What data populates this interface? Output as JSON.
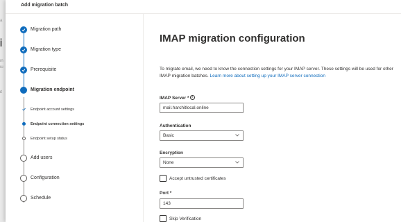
{
  "panel": {
    "title": "Add migration batch"
  },
  "stepper": {
    "steps": [
      {
        "label": "Migration path",
        "state": "done"
      },
      {
        "label": "Migration type",
        "state": "done"
      },
      {
        "label": "Prerequisite",
        "state": "done"
      },
      {
        "label": "Migration endpoint",
        "state": "current"
      },
      {
        "label": "Add users",
        "state": "todo"
      },
      {
        "label": "Configuration",
        "state": "todo"
      },
      {
        "label": "Schedule",
        "state": "todo"
      }
    ],
    "substeps": [
      {
        "label": "Endpoint account settings",
        "state": "done"
      },
      {
        "label": "Endpoint connection settings",
        "state": "current"
      },
      {
        "label": "Endpoint setup status",
        "state": "todo"
      }
    ]
  },
  "main": {
    "title": "IMAP migration configuration",
    "description": "To migrate email, we need to know the connection settings for your IMAP server. These settings will be used for other IMAP migration batches.",
    "learn_more_link": "Learn more about setting up your IMAP server connection",
    "imap_server": {
      "label": "IMAP Server",
      "required_mark": "*",
      "value": "mail.harchitlocal.online"
    },
    "authentication": {
      "label": "Authentication",
      "value": "Basic"
    },
    "encryption": {
      "label": "Encryption",
      "value": "None"
    },
    "untrusted_certs": {
      "label": "Accept untrusted certificates",
      "checked": false
    },
    "port": {
      "label": "Port *",
      "value": "143"
    },
    "skip_verification": {
      "label": "Skip Verification",
      "checked": false
    }
  },
  "colors": {
    "accent": "#0f6cbd",
    "text": "#323130",
    "border": "#8a8886"
  }
}
